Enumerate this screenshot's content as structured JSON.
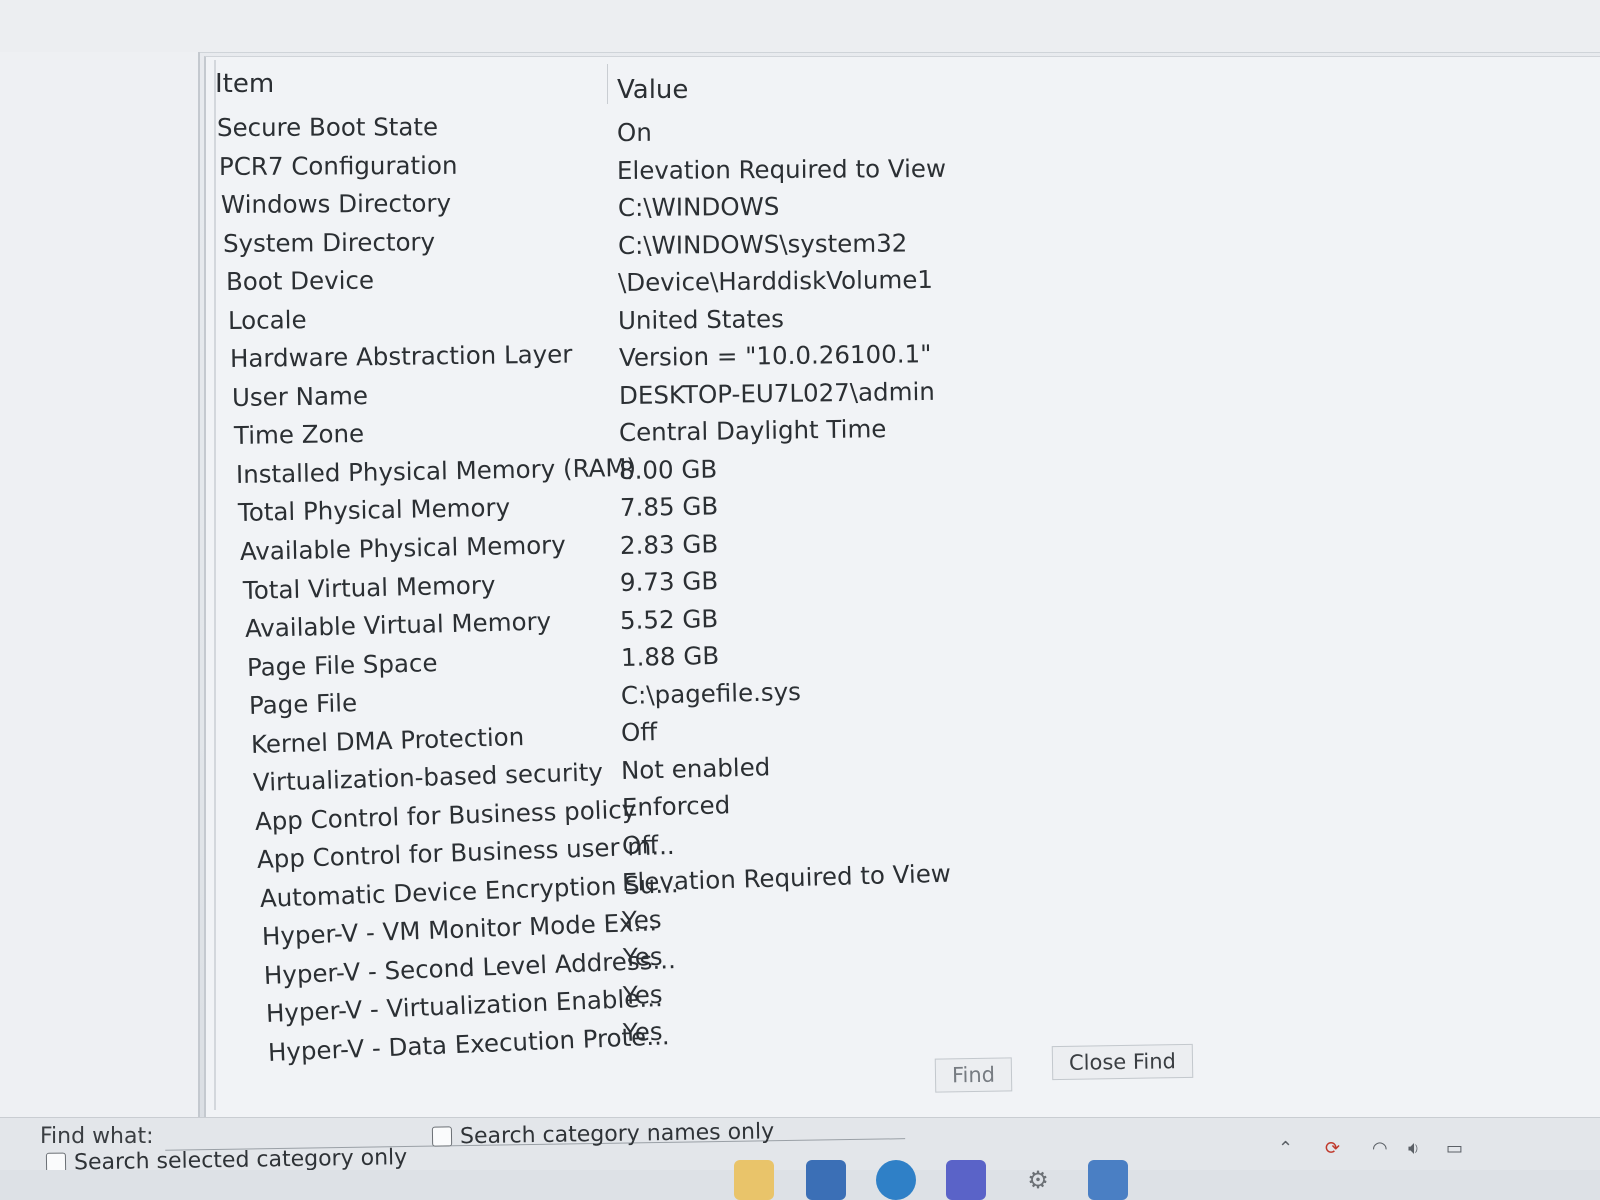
{
  "columns": {
    "item": "Item",
    "value": "Value"
  },
  "rows": [
    {
      "item": "Secure Boot State",
      "value": "On"
    },
    {
      "item": "PCR7 Configuration",
      "value": "Elevation Required to View"
    },
    {
      "item": "Windows Directory",
      "value": "C:\\WINDOWS"
    },
    {
      "item": "System Directory",
      "value": "C:\\WINDOWS\\system32"
    },
    {
      "item": "Boot Device",
      "value": "\\Device\\HarddiskVolume1"
    },
    {
      "item": "Locale",
      "value": "United States"
    },
    {
      "item": "Hardware Abstraction Layer",
      "value": "Version = \"10.0.26100.1\""
    },
    {
      "item": "User Name",
      "value": "DESKTOP-EU7L027\\admin"
    },
    {
      "item": "Time Zone",
      "value": "Central Daylight Time"
    },
    {
      "item": "Installed Physical Memory (RAM)",
      "value": "8.00 GB"
    },
    {
      "item": "Total Physical Memory",
      "value": "7.85 GB"
    },
    {
      "item": "Available Physical Memory",
      "value": "2.83 GB"
    },
    {
      "item": "Total Virtual Memory",
      "value": "9.73 GB"
    },
    {
      "item": "Available Virtual Memory",
      "value": "5.52 GB"
    },
    {
      "item": "Page File Space",
      "value": "1.88 GB"
    },
    {
      "item": "Page File",
      "value": "C:\\pagefile.sys"
    },
    {
      "item": "Kernel DMA Protection",
      "value": "Off"
    },
    {
      "item": "Virtualization-based security",
      "value": "Not enabled"
    },
    {
      "item": "App Control for Business policy",
      "value": "Enforced"
    },
    {
      "item": "App Control for Business user m...",
      "value": "Off"
    },
    {
      "item": "Automatic Device Encryption Su...",
      "value": "Elevation Required to View"
    },
    {
      "item": "Hyper-V - VM Monitor Mode Ex...",
      "value": "Yes"
    },
    {
      "item": "Hyper-V - Second Level Address...",
      "value": "Yes"
    },
    {
      "item": "Hyper-V - Virtualization Enable...",
      "value": "Yes"
    },
    {
      "item": "Hyper-V - Data Execution Prote...",
      "value": "Yes"
    }
  ],
  "find": {
    "label": "Find what:",
    "value": "",
    "find_button": "Find",
    "close_button": "Close Find",
    "search_selected_category": "Search selected category only",
    "search_category_names": "Search category names only"
  },
  "taskbar": {
    "icons": [
      "file-explorer-icon",
      "store-icon",
      "edge-icon",
      "teams-icon",
      "settings-icon",
      "system-information-icon"
    ],
    "tray_icons": [
      "chevron-up-icon",
      "update-icon",
      "wifi-icon",
      "volume-icon",
      "battery-icon"
    ]
  }
}
